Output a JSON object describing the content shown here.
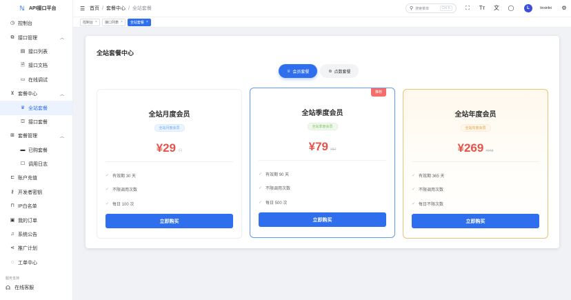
{
  "app": {
    "title": "API接口平台",
    "logo_icon": "api-logo-icon"
  },
  "sidebar": {
    "items": [
      {
        "name": "dashboard",
        "label": "控制台",
        "icon": "dashboard-icon"
      },
      {
        "name": "api-management",
        "label": "接口管理",
        "icon": "api-icon",
        "expanded": true
      },
      {
        "name": "api-list",
        "label": "接口列表",
        "icon": "list-icon",
        "sub": true
      },
      {
        "name": "api-docs",
        "label": "接口文档",
        "icon": "document-icon",
        "sub": true
      },
      {
        "name": "online-debug",
        "label": "在线调试",
        "icon": "monitor-icon",
        "sub": true
      },
      {
        "name": "plan-center",
        "label": "套餐中心",
        "icon": "cart-icon",
        "expanded": true
      },
      {
        "name": "site-plans",
        "label": "全站套餐",
        "icon": "crown-icon",
        "sub": true,
        "active": true
      },
      {
        "name": "api-plans",
        "label": "接口套餐",
        "icon": "box-icon",
        "sub": true
      },
      {
        "name": "plan-management",
        "label": "套餐管理",
        "icon": "grid-icon",
        "expanded": true
      },
      {
        "name": "purchased-plans",
        "label": "已购套餐",
        "icon": "ticket-icon",
        "sub": true
      },
      {
        "name": "call-logs",
        "label": "调用日志",
        "icon": "log-icon",
        "sub": true
      },
      {
        "name": "recharge",
        "label": "账户充值",
        "icon": "wallet-icon"
      },
      {
        "name": "developer-keys",
        "label": "开发者密钥",
        "icon": "key-icon"
      },
      {
        "name": "ip-whitelist",
        "label": "IP白名单",
        "icon": "lock-icon"
      },
      {
        "name": "my-orders",
        "label": "我的订单",
        "icon": "order-icon"
      },
      {
        "name": "announcements",
        "label": "系统公告",
        "icon": "bell-icon"
      },
      {
        "name": "referral",
        "label": "推广计划",
        "icon": "share-icon"
      },
      {
        "name": "tickets",
        "label": "工单中心",
        "icon": "chat-icon"
      }
    ],
    "service_label": "服务支持",
    "support_label": "在线客服"
  },
  "header": {
    "breadcrumb": [
      "首页",
      "套餐中心",
      "全站套餐"
    ],
    "search_placeholder": "搜索菜单",
    "search_shortcut": "Ctrl K",
    "user_initial": "L",
    "user_name": "linxinfei"
  },
  "tags": [
    {
      "label": "控制台",
      "active": false
    },
    {
      "label": "接口列表",
      "active": false
    },
    {
      "label": "全站套餐",
      "active": true
    }
  ],
  "main": {
    "title": "全站套餐中心",
    "switch": {
      "member": "会员套餐",
      "points": "点数套餐",
      "active": "member"
    },
    "plans": [
      {
        "name": "全站月度会员",
        "tag": "全站月度会员",
        "tag_color": "blue",
        "price": "¥29",
        "old_price": "/月",
        "badge": "",
        "features": [
          "有效期 30 天",
          "不限调用次数",
          "每日 100 次"
        ],
        "button": "立即购买"
      },
      {
        "name": "全站季度会员",
        "tag": "全站季度会员",
        "tag_color": "green",
        "price": "¥79",
        "old_price": "¥87",
        "badge": "推荐",
        "features": [
          "有效期 90 天",
          "不限调用次数",
          "每日 500 次"
        ],
        "button": "立即购买"
      },
      {
        "name": "全站年度会员",
        "tag": "全站年度会员",
        "tag_color": "orange",
        "price": "¥269",
        "old_price": "¥348",
        "badge": "",
        "features": [
          "有效期 365 天",
          "不限调用次数",
          "每日不限次数"
        ],
        "button": "立即购买"
      }
    ]
  },
  "colors": {
    "primary": "#2f6fed",
    "price": "#e5534b",
    "badge": "#f56c6c",
    "gold_border": "#e8c37a",
    "blue_border": "#5b9bf0"
  }
}
